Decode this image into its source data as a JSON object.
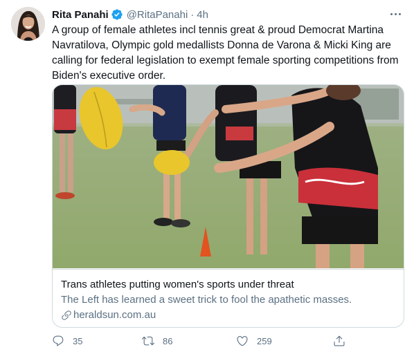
{
  "tweet": {
    "author": {
      "name": "Rita Panahi",
      "handle": "@RitaPanahi",
      "separator": "·",
      "time": "4h"
    },
    "text": "A group of female athletes incl tennis great & proud Democrat Martina Navratilova, Olympic gold medallists Donna de Varona & Micki King are calling for federal legislation to exempt female sporting competitions from Biden's executive order.",
    "card": {
      "title": "Trans athletes putting women's sports under threat",
      "description": "The Left has learned a sweet trick to fool the apathetic masses.",
      "domain": "heraldsun.com.au"
    },
    "actions": {
      "replies": "35",
      "retweets": "86",
      "likes": "259"
    }
  },
  "colors": {
    "text": "#0f1419",
    "secondary": "#5b7083",
    "verified": "#1da1f2",
    "border": "#cfd9de"
  },
  "icons": [
    "verified-badge-icon",
    "more-caret-icon",
    "link-icon",
    "reply-icon",
    "retweet-icon",
    "like-icon",
    "share-icon"
  ]
}
